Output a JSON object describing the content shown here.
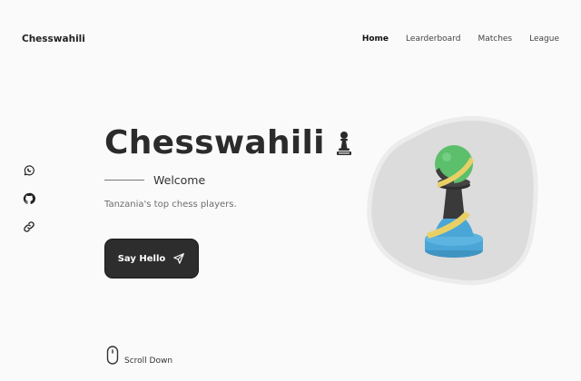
{
  "header": {
    "brand": "Chesswahili",
    "nav": [
      {
        "label": "Home",
        "active": true
      },
      {
        "label": "Learderboard",
        "active": false
      },
      {
        "label": "Matches",
        "active": false
      },
      {
        "label": "League",
        "active": false
      }
    ]
  },
  "social": [
    {
      "icon": "whatsapp-icon"
    },
    {
      "icon": "github-icon"
    },
    {
      "icon": "link-icon"
    }
  ],
  "hero": {
    "title": "Chesswahili",
    "title_icon": "chess-pawn-icon",
    "subtitle": "Welcome",
    "tagline": "Tanzania's top chess players.",
    "cta_label": "Say Hello",
    "cta_icon": "send-icon"
  },
  "scroll": {
    "label": "Scroll Down",
    "icon": "mouse-icon"
  },
  "colors": {
    "background": "#fafafa",
    "button": "#2d2d2d",
    "blob": "#dcdcdc",
    "pawn_green": "#5cbf6b",
    "pawn_yellow": "#e8d066",
    "pawn_black": "#3a3a3a",
    "pawn_blue": "#4aa6d6"
  }
}
